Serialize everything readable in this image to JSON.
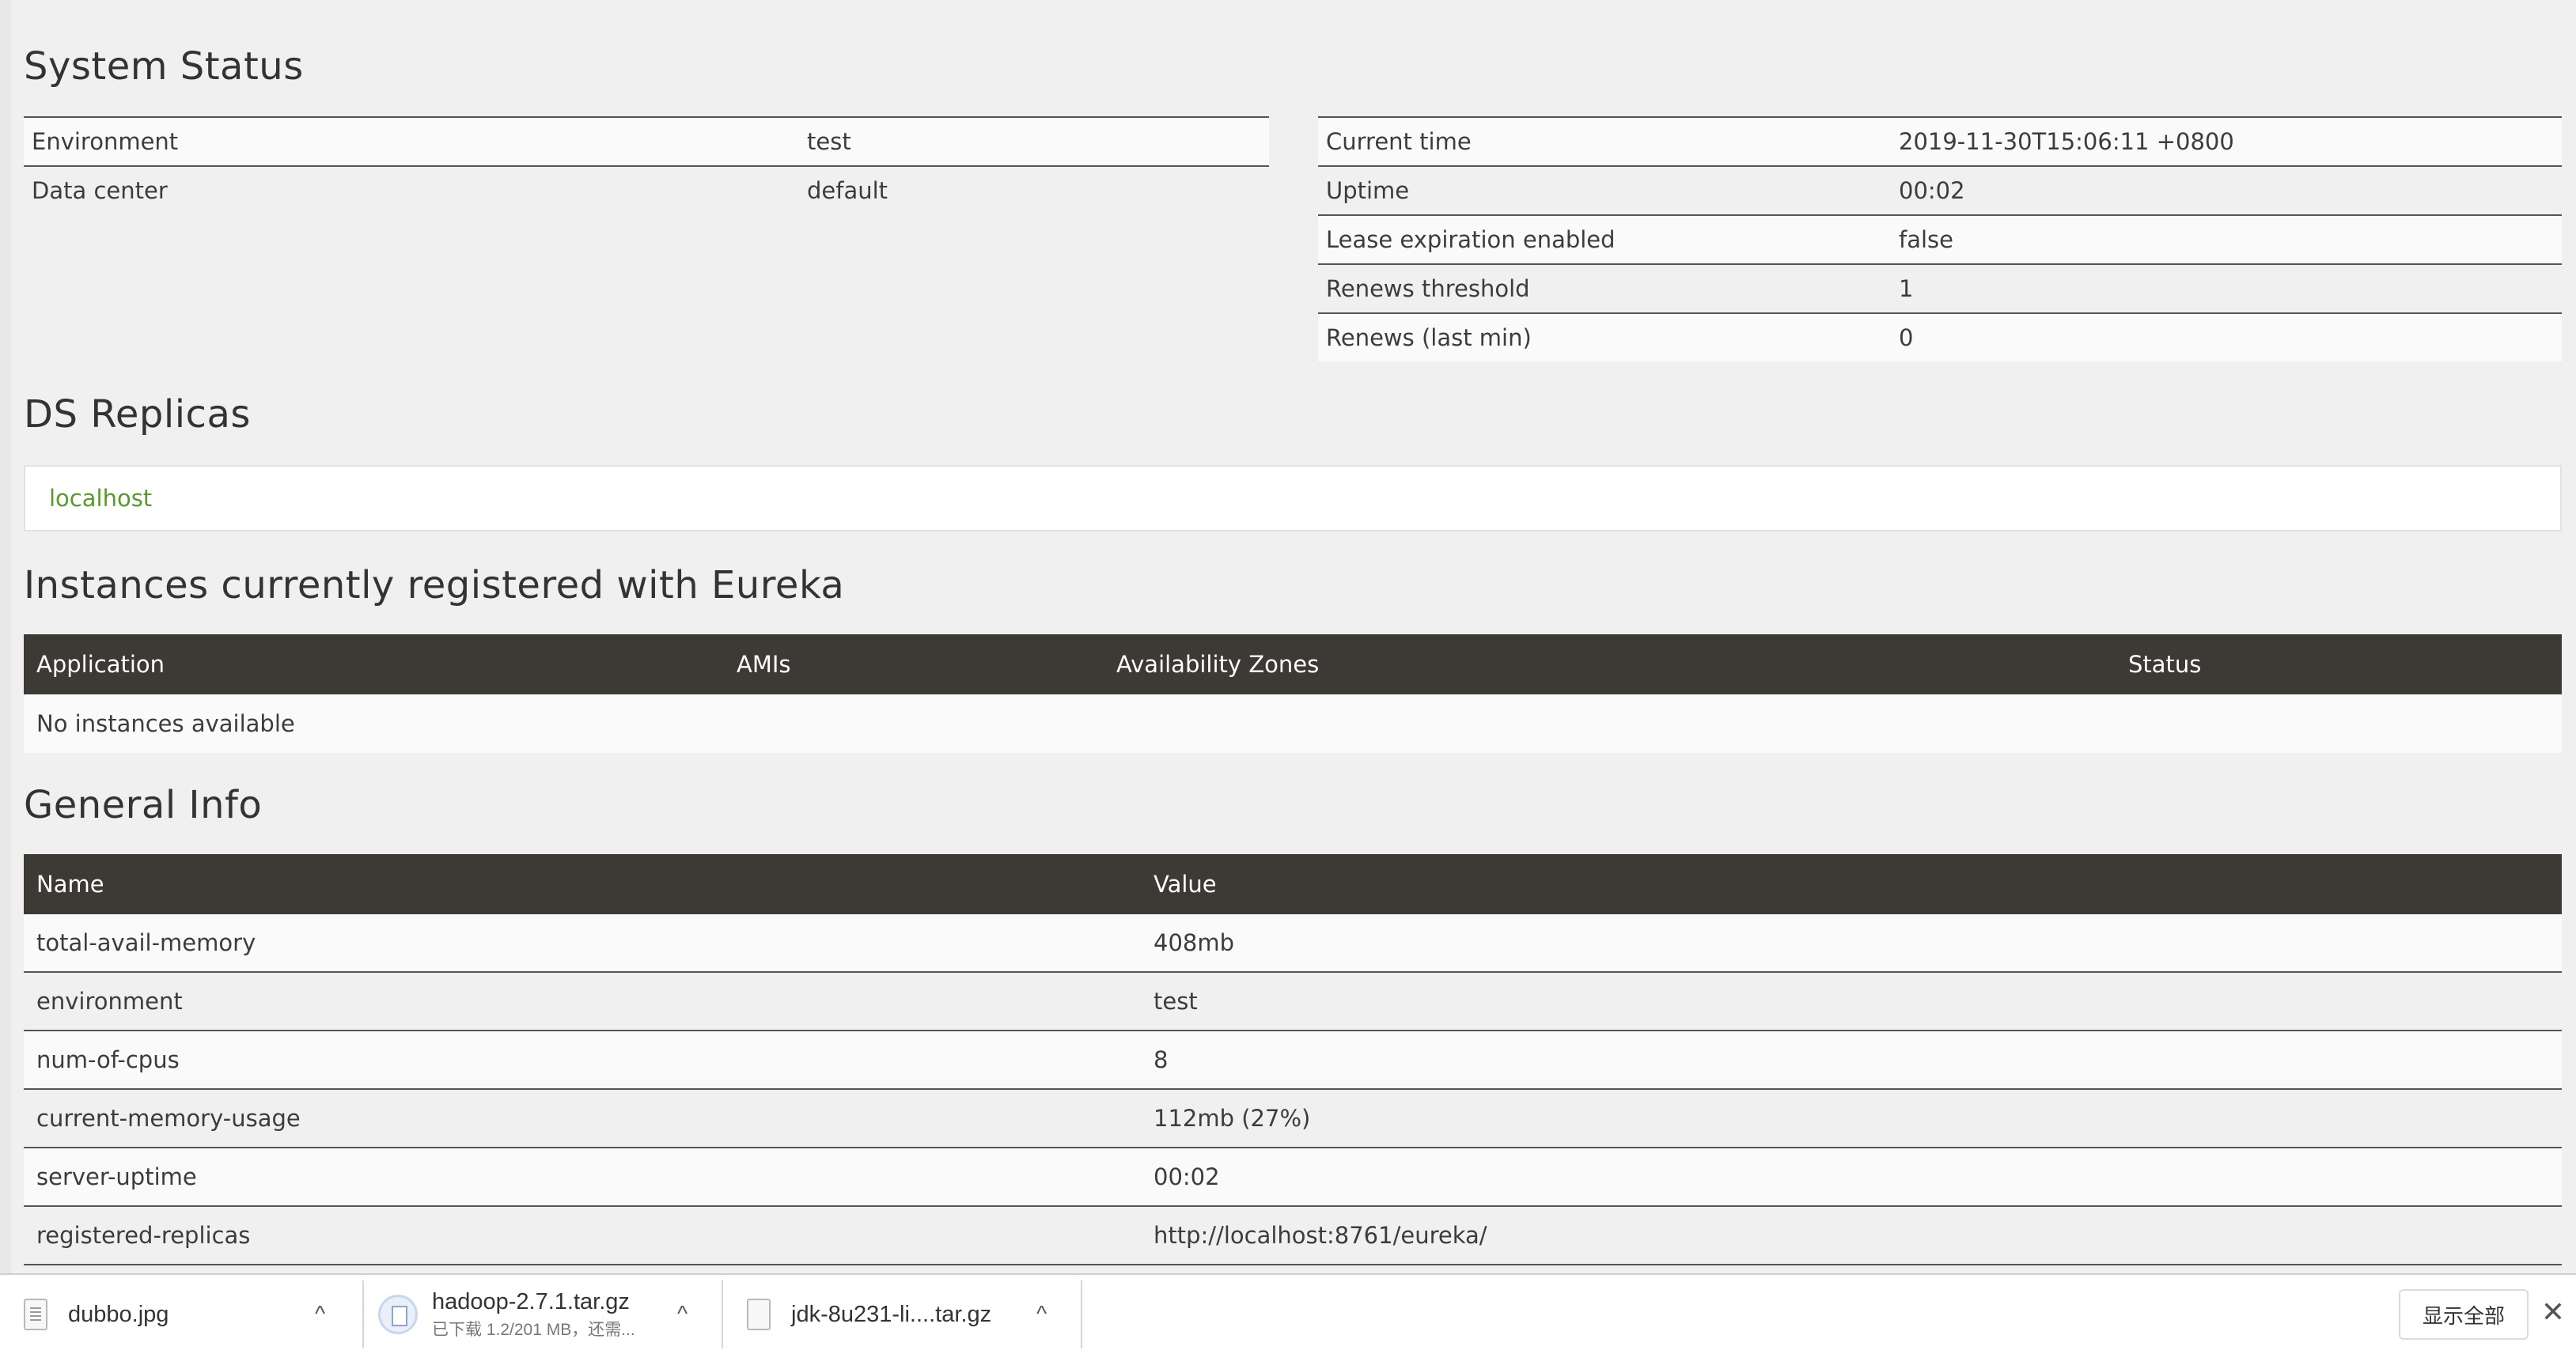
{
  "system_status": {
    "title": "System Status",
    "left": [
      {
        "name": "Environment",
        "value": "test"
      },
      {
        "name": "Data center",
        "value": "default"
      }
    ],
    "right": [
      {
        "name": "Current time",
        "value": "2019-11-30T15:06:11 +0800"
      },
      {
        "name": "Uptime",
        "value": "00:02"
      },
      {
        "name": "Lease expiration enabled",
        "value": "false"
      },
      {
        "name": "Renews threshold",
        "value": "1"
      },
      {
        "name": "Renews (last min)",
        "value": "0"
      }
    ]
  },
  "ds_replicas": {
    "title": "DS Replicas",
    "items": [
      "localhost"
    ]
  },
  "instances": {
    "title": "Instances currently registered with Eureka",
    "headers": [
      "Application",
      "AMIs",
      "Availability Zones",
      "Status"
    ],
    "empty_text": "No instances available"
  },
  "general_info": {
    "title": "General Info",
    "headers": [
      "Name",
      "Value"
    ],
    "rows": [
      {
        "name": "total-avail-memory",
        "value": "408mb"
      },
      {
        "name": "environment",
        "value": "test"
      },
      {
        "name": "num-of-cpus",
        "value": "8"
      },
      {
        "name": "current-memory-usage",
        "value": "112mb (27%)"
      },
      {
        "name": "server-uptime",
        "value": "00:02"
      },
      {
        "name": "registered-replicas",
        "value": "http://localhost:8761/eureka/"
      }
    ]
  },
  "download_bar": {
    "items": [
      {
        "name": "dubbo.jpg",
        "sub": "",
        "icon": "image-file-icon"
      },
      {
        "name": "hadoop-2.7.1.tar.gz",
        "sub": "已下载 1.2/201 MB，还需...",
        "icon": "downloading-file-icon"
      },
      {
        "name": "jdk-8u231-li....tar.gz",
        "sub": "",
        "icon": "file-icon"
      }
    ],
    "show_all": "显示全部",
    "close": "✕",
    "chevron": "^"
  }
}
